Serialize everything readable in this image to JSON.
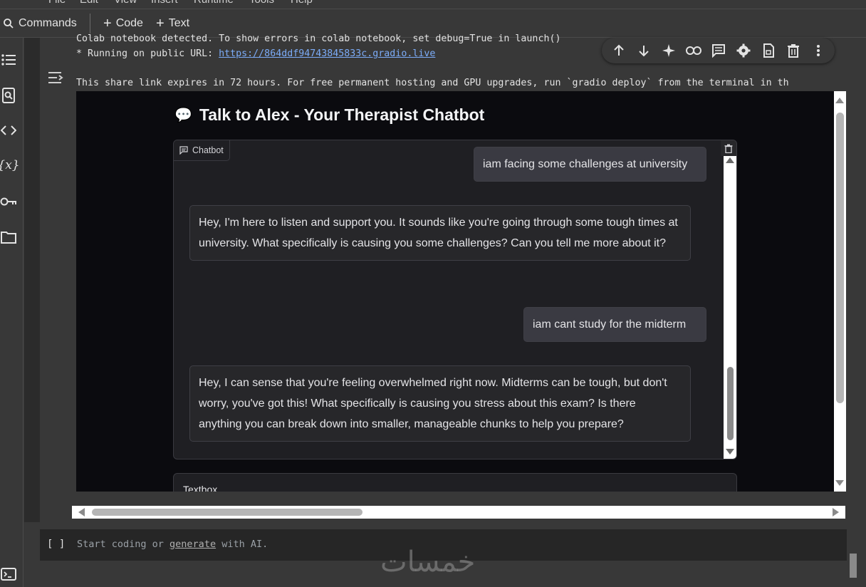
{
  "menubar": [
    "File",
    "Edit",
    "View",
    "Insert",
    "Runtime",
    "Tools",
    "Help"
  ],
  "toolbar": {
    "commands_label": "Commands",
    "code_label": "Code",
    "text_label": "Text"
  },
  "output": {
    "line1": "Colab notebook detected. To show errors in colab notebook, set debug=True in launch()",
    "line2_prefix": "* Running on public URL: ",
    "url": "https://864ddf94743845833c.gradio.live",
    "line3": "This share link expires in 72 hours. For free permanent hosting and GPU upgrades, run `gradio deploy` from the terminal in th"
  },
  "gradio": {
    "title": "Talk to Alex - Your Therapist Chatbot",
    "title_emoji": "💬",
    "chatbot_label": "Chatbot",
    "textbox_label": "Textbox",
    "messages": [
      {
        "role": "user",
        "text": "iam facing some challenges at university"
      },
      {
        "role": "bot",
        "text": "Hey, I'm here to listen and support you. It sounds like you're going through some tough times at university. What specifically is causing you some challenges? Can you tell me more about it?"
      },
      {
        "role": "user",
        "text": "iam cant study for the midterm"
      },
      {
        "role": "bot",
        "text": "Hey, I can sense that you're feeling overwhelmed right now. Midterms can be tough, but don't worry, you've got this! What specifically is causing you stress about this exam? Is there anything you can break down into smaller, manageable chunks to help you prepare?"
      }
    ]
  },
  "next_cell": {
    "brackets": "[ ]",
    "placeholder_start": "Start coding or ",
    "placeholder_link": "generate",
    "placeholder_end": " with AI."
  },
  "watermark": "خمسات",
  "colors": {
    "app_bg": "#383838",
    "gradio_bg": "#0b0b0f",
    "link": "#7cacf8",
    "user_bubble": "#3a3a42",
    "bot_bubble": "#27272a"
  }
}
